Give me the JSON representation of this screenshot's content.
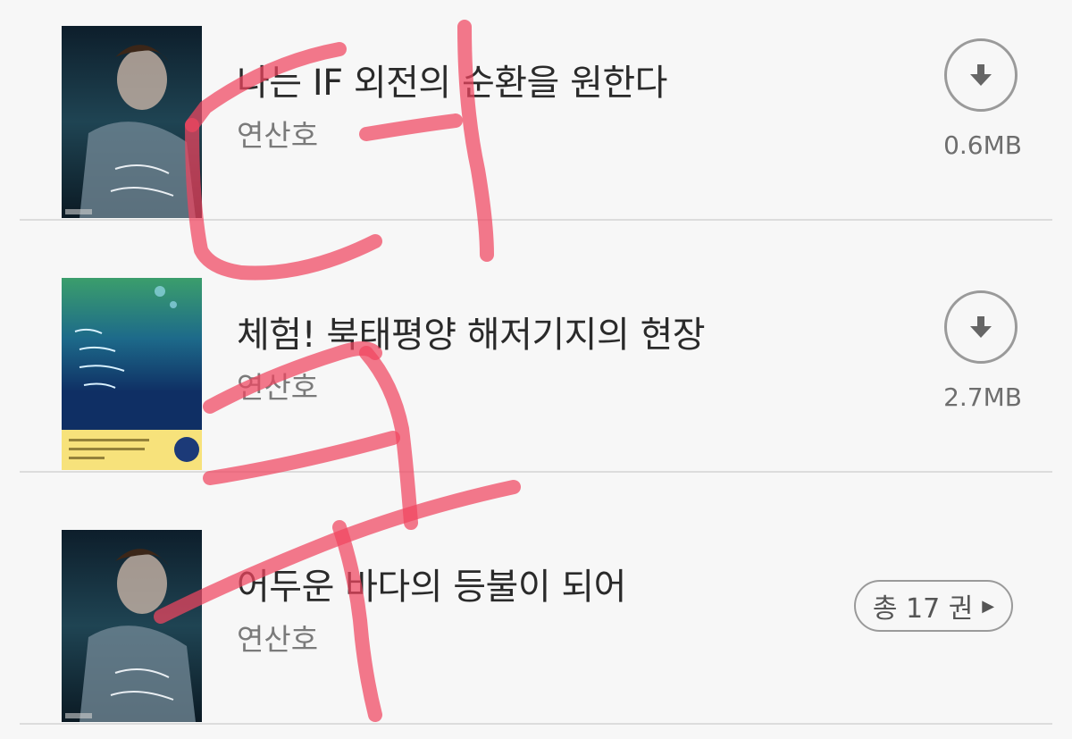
{
  "books": [
    {
      "title": "나는 IF 외전의 순환을 원한다",
      "author": "연산호",
      "action": "download",
      "size": "0.6MB",
      "cover": "dark-sea-cover",
      "icon": "download-arrow-icon"
    },
    {
      "title": "체험! 북태평양 해저기지의 현장",
      "author": "연산호",
      "action": "download",
      "size": "2.7MB",
      "cover": "blue-green-yellow-cover",
      "icon": "download-arrow-icon"
    },
    {
      "title": "어두운 바다의 등불이 되어",
      "author": "연산호",
      "action": "volumes",
      "volumes_label": "총 17 권",
      "cover": "dark-sea-cover",
      "icon": "chevron-right-icon"
    }
  ],
  "overlay": {
    "type": "handwritten-scribble",
    "color": "#f0455f"
  }
}
